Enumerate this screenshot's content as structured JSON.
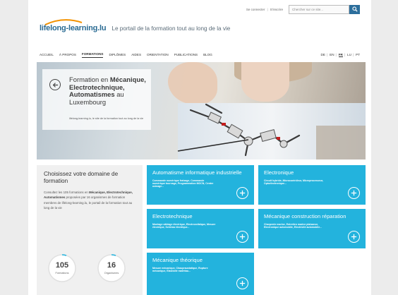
{
  "util": {
    "connect": "Se connecter",
    "register": "S'inscrire",
    "search_placeholder": "Chercher sur ce site..."
  },
  "logo": {
    "text": "lifelong-learning.lu",
    "tagline": "Le portail de la formation tout au long de la vie"
  },
  "nav": {
    "items": [
      "Accueil",
      "À propos",
      "Formations",
      "Diplômes",
      "Aides",
      "Orientation",
      "Publications",
      "Blog"
    ],
    "active_index": 2,
    "languages": [
      "DE",
      "EN",
      "FR",
      "LU",
      "PT"
    ],
    "active_language": "FR"
  },
  "hero": {
    "title_prefix": "Formation en ",
    "title_bold": "Mécanique, Electrotechnique, Automatismes",
    "title_mid": " au ",
    "title_suffix": "Luxembourg",
    "subtitle": "lifelong-learning.lu, le site de la formation tout au long de la vie"
  },
  "info": {
    "heading": "Choisissez votre domaine de formation",
    "text_1": "Consultez les 105 formations en ",
    "text_bold": "Mécanique, Electrotechnique, Automatismes",
    "text_2": " proposées par 16 organismes de formation membres de lifelong-learning.lu, le portail de la formation tout au long de la vie",
    "stats": [
      {
        "value": "105",
        "label": "Formations"
      },
      {
        "value": "16",
        "label": "Organismes"
      }
    ]
  },
  "tiles": [
    {
      "title": "Automatisme informatique industrielle",
      "desc": "Commande numérique fraisage, Commande numérique tournage, Programmation MOCN, Centre usinage..."
    },
    {
      "title": "Electronique",
      "desc": "Circuit hybride, Microcontrôleur, Microprocesseur, Optoélectronique..."
    },
    {
      "title": "Electrotechnique",
      "desc": "Montage câblage électrique, Electrovoltaïque, Mesure électrique, Schéma électrique..."
    },
    {
      "title": "Mécanique construction réparation",
      "desc": "Charpente marine, Entretien marine plaisance, Electronique automobile, Electricité automobile..."
    },
    {
      "title": "Mécanique théorique",
      "desc": "Mesure mécanique, Chaupraustatique, Rupture mécanique, Elasticité matériau..."
    }
  ],
  "colors": {
    "accent": "#23b3dd",
    "logo_blue": "#2a6b93",
    "logo_orange": "#f39200",
    "search_button": "#2c6e9c"
  }
}
